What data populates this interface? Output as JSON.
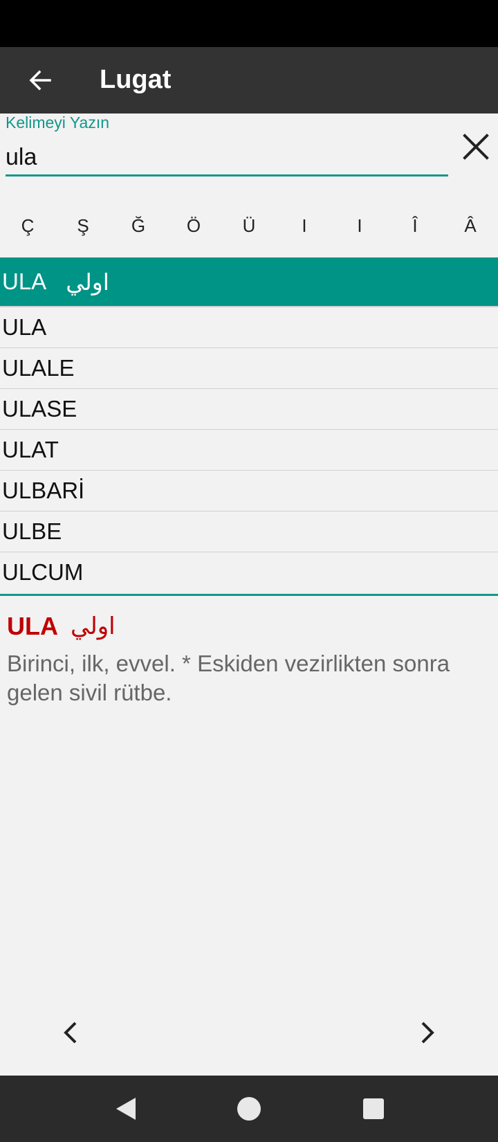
{
  "appbar": {
    "title": "Lugat",
    "back_icon": "arrow-left-icon"
  },
  "search": {
    "hint": "Kelimeyi Yazın",
    "value": "ula",
    "clear_icon": "close-icon"
  },
  "special_chars": [
    "Ç",
    "Ş",
    "Ğ",
    "Ö",
    "Ü",
    "I",
    "I",
    "Î",
    "Â"
  ],
  "list": {
    "selected": {
      "word": "ULA",
      "arabic": "اولي"
    },
    "items": [
      "ULA",
      "ULALE",
      "ULASE",
      "ULAT",
      "ULBARİ",
      "ULBE",
      "ULCUM"
    ]
  },
  "definition": {
    "word": "ULA",
    "arabic": "اولي",
    "text": "Birinci, ilk, evvel. * Eskiden vezirlikten sonra gelen sivil rütbe."
  },
  "colors": {
    "accent": "#009486",
    "definition_word": "#c00000",
    "appbar": "#333333"
  }
}
